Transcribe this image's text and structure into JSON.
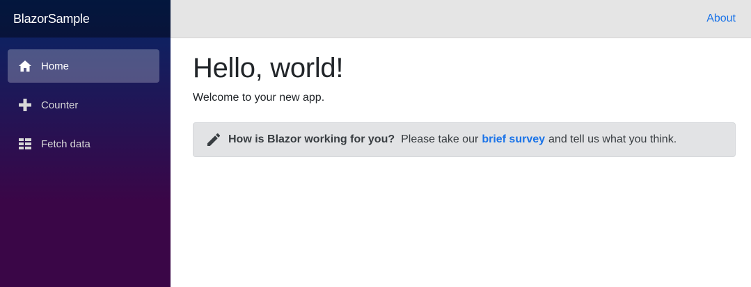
{
  "brand": "BlazorSample",
  "nav": {
    "items": [
      {
        "label": "Home",
        "icon": "home-icon",
        "active": true
      },
      {
        "label": "Counter",
        "icon": "plus-icon",
        "active": false
      },
      {
        "label": "Fetch data",
        "icon": "list-icon",
        "active": false
      }
    ]
  },
  "top_row": {
    "about_label": "About"
  },
  "page": {
    "title": "Hello, world!",
    "welcome": "Welcome to your new app."
  },
  "survey": {
    "icon": "pencil-icon",
    "question": "How is Blazor working for you?",
    "before_link": "Please take our",
    "link_text": "brief survey",
    "after_link": "and tell us what you think."
  },
  "colors": {
    "sidebar_top": "#052767",
    "sidebar_bottom": "#3a0647",
    "link": "#1a73e8",
    "top_row_bg": "#e5e5e5",
    "alert_bg": "#e2e3e5"
  }
}
